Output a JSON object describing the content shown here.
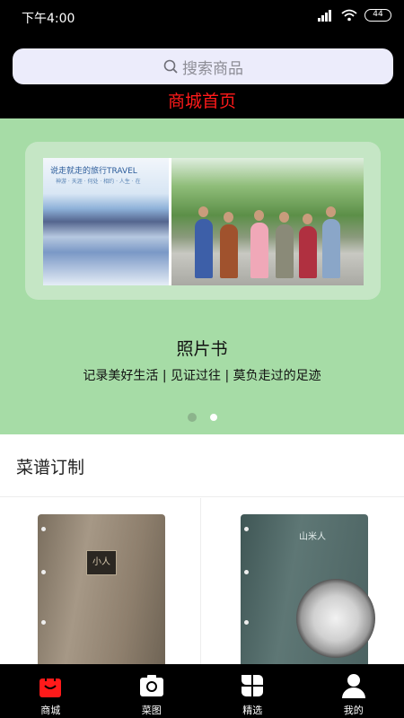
{
  "status_bar": {
    "time": "下午4:00",
    "battery": "44"
  },
  "header": {
    "search_placeholder": "搜索商品",
    "title": "商城首页"
  },
  "banner": {
    "cover_text": "说走就走的旅行TRAVEL",
    "cover_subtext": "神游 · 天涯 · 何处 · 相约 · 人生 · 在",
    "title": "照片书",
    "subtitle": "记录美好生活 | 见证过往 | 莫负走过的足迹",
    "dots": [
      {
        "active": false
      },
      {
        "active": true
      }
    ]
  },
  "section": {
    "title": "菜谱订制"
  },
  "products": [
    {
      "logo_text": "小人"
    },
    {
      "logo_text": "山米人"
    }
  ],
  "tabs": [
    {
      "label": "商城",
      "icon": "shopping-bag-icon",
      "active": true
    },
    {
      "label": "菜图",
      "icon": "camera-icon",
      "active": false
    },
    {
      "label": "精选",
      "icon": "grid-petals-icon",
      "active": false
    },
    {
      "label": "我的",
      "icon": "user-icon",
      "active": false
    }
  ],
  "colors": {
    "accent": "#ff1a1a",
    "banner_bg": "#a6dca6",
    "search_bg": "#ececfb"
  }
}
